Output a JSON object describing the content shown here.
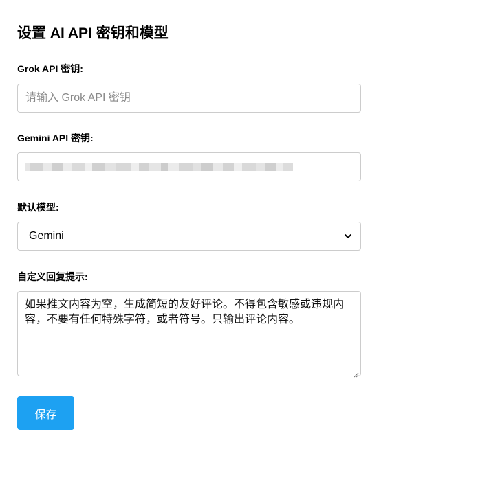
{
  "page": {
    "title": "设置 AI API 密钥和模型"
  },
  "grok": {
    "label": "Grok API 密钥:",
    "placeholder": "请输入 Grok API 密钥",
    "value": ""
  },
  "gemini": {
    "label": "Gemini API 密钥:",
    "value_masked": "(redacted / blurred key)"
  },
  "model": {
    "label": "默认模型:",
    "selected": "Gemini"
  },
  "prompt": {
    "label": "自定义回复提示:",
    "value": "如果推文内容为空，生成简短的友好评论。不得包含敏感或违规内容，不要有任何特殊字符，或者符号。只输出评论内容。"
  },
  "actions": {
    "save_label": "保存"
  },
  "colors": {
    "accent": "#1da1f2",
    "border": "#cccccc"
  }
}
